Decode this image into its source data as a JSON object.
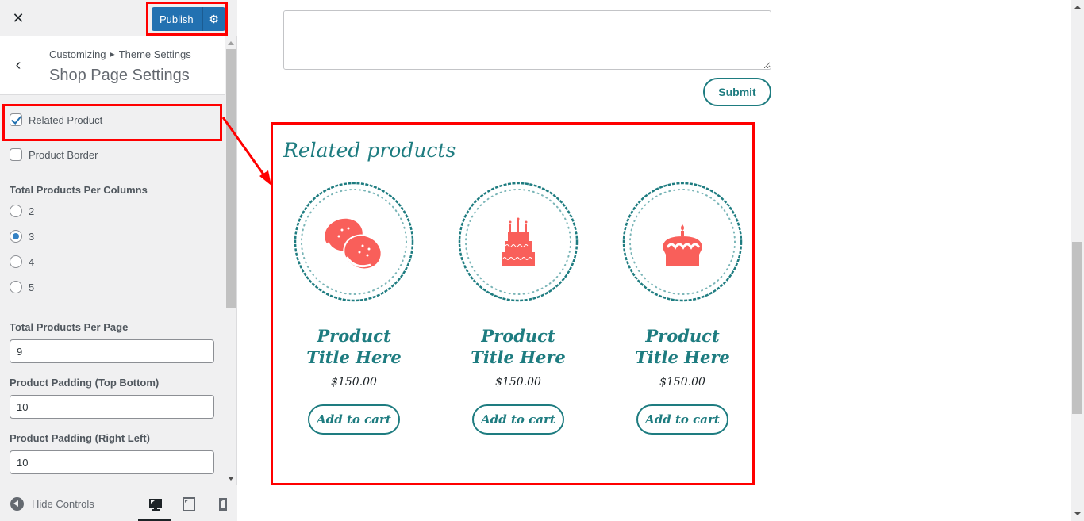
{
  "sidebar": {
    "close_icon": "close-icon",
    "publish_label": "Publish",
    "publish_settings_icon": "gear-icon",
    "breadcrumb": {
      "root": "Customizing",
      "separator_icon": "triangle-right-icon",
      "parent": "Theme Settings"
    },
    "section_title": "Shop Page Settings",
    "controls": {
      "related_product": {
        "label": "Related Product",
        "checked": true
      },
      "product_border": {
        "label": "Product Border",
        "checked": false
      },
      "per_columns": {
        "label": "Total Products Per Columns",
        "options": [
          "2",
          "3",
          "4",
          "5"
        ],
        "selected": "3"
      },
      "per_page": {
        "label": "Total Products Per Page",
        "value": "9"
      },
      "padding_tb": {
        "label": "Product Padding (Top Bottom)",
        "value": "10"
      },
      "padding_rl": {
        "label": "Product Padding (Right Left)",
        "value": "10"
      }
    },
    "footer": {
      "hide_controls": "Hide Controls",
      "devices": [
        "desktop",
        "tablet",
        "mobile"
      ],
      "active_device": "desktop"
    }
  },
  "preview": {
    "textarea_value": "",
    "submit_label": "Submit",
    "related_heading": "Related products",
    "products": [
      {
        "name": "Product Title Here",
        "price": "$150.00",
        "button": "Add to cart",
        "icon": "macarons-icon"
      },
      {
        "name": "Product Title Here",
        "price": "$150.00",
        "button": "Add to cart",
        "icon": "birthday-cake-icon"
      },
      {
        "name": "Product Title Here",
        "price": "$150.00",
        "button": "Add to cart",
        "icon": "cupcake-icon"
      }
    ]
  },
  "colors": {
    "accent_teal": "#1e7c80",
    "publish_blue": "#2271b1",
    "annotation_red": "#ff0000",
    "product_icon_coral": "#f95f5a"
  }
}
